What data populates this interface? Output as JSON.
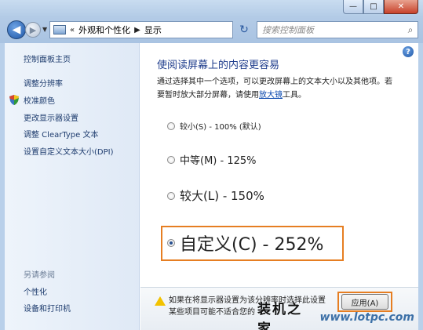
{
  "window": {
    "controls": {
      "minimize": "—",
      "maximize": "□",
      "close": "✕"
    }
  },
  "nav": {
    "back_icon": "◀",
    "forward_icon": "▶",
    "dropdown_icon": "▼",
    "breadcrumb_prefix": "«",
    "breadcrumb": [
      "外观和个性化",
      "显示"
    ],
    "separator": "▶",
    "address_dropdown": "▼",
    "refresh_icon": "↻"
  },
  "search": {
    "placeholder": "搜索控制面板",
    "icon": "⌕"
  },
  "left_pane": {
    "home": "控制面板主页",
    "links": [
      "调整分辨率",
      "校准颜色",
      "更改显示器设置",
      "调整 ClearType 文本",
      "设置自定义文本大小(DPI)"
    ],
    "see_also_header": "另请参阅",
    "see_also": [
      "个性化",
      "设备和打印机"
    ]
  },
  "main": {
    "help_icon": "?",
    "heading": "使阅读屏幕上的内容更容易",
    "description_1": "通过选择其中一个选项，可以更改屏幕上的文本大小以及其他项。若",
    "description_2_pre": "要暂时放大部分屏幕，请使用",
    "description_2_link": "放大镜",
    "description_2_post": "工具。",
    "options": [
      {
        "label": "较小(S) - 100% (默认)",
        "selected": false
      },
      {
        "label": "中等(M) - 125%",
        "selected": false
      },
      {
        "label": "较大(L) - 150%",
        "selected": false
      },
      {
        "label": "自定义(C) - 252%",
        "selected": true
      }
    ],
    "accent_color": "#e67e22"
  },
  "warning": {
    "line1": "如果在将显示器设置为该分辨率时选择此设置",
    "line2": "某些项目可能不适合您的",
    "apply_label": "应用(A)"
  },
  "watermark": {
    "cn": "装机之家",
    "en": "www.lotpc.com"
  }
}
